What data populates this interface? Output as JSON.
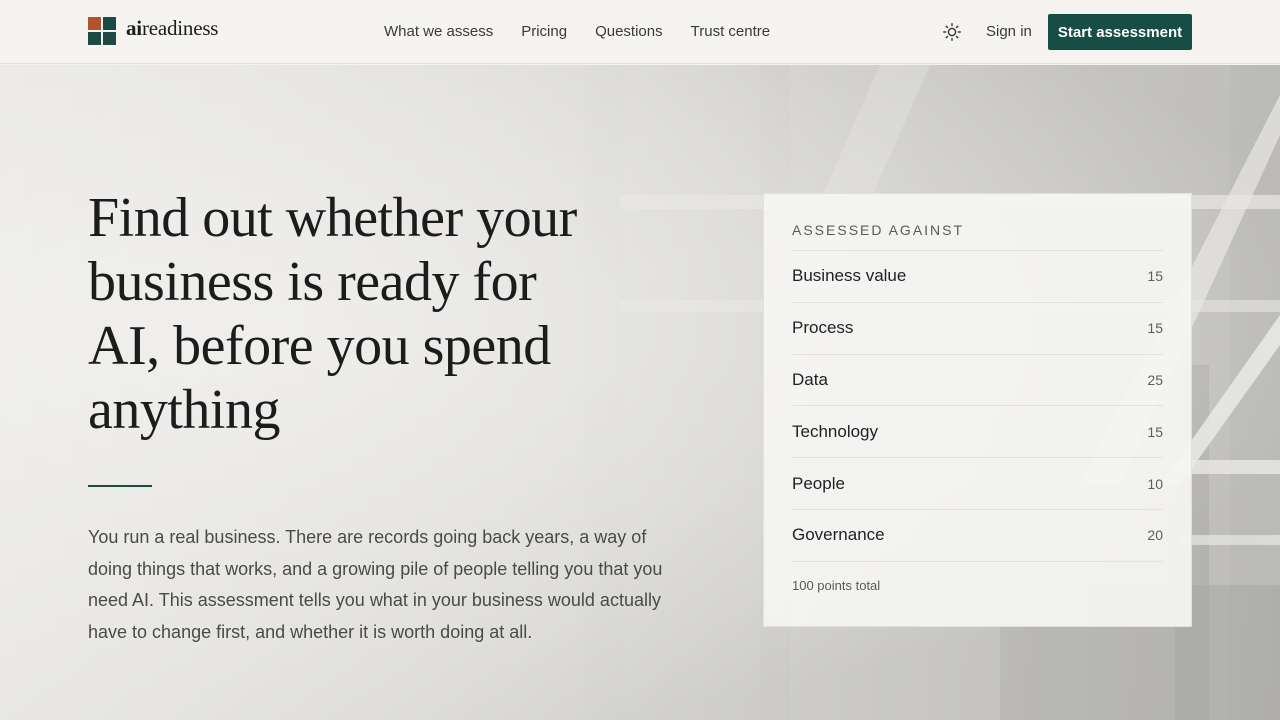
{
  "brand": {
    "name_bold": "ai",
    "name_rest": "readiness"
  },
  "nav": {
    "items": [
      "What we assess",
      "Pricing",
      "Questions",
      "Trust centre"
    ]
  },
  "header": {
    "theme_icon": "sun-icon",
    "sign_in": "Sign in",
    "cta": "Start assessment"
  },
  "colors": {
    "accent": "#184d46",
    "logo_orange": "#b2532f",
    "logo_green": "#1c4a44"
  },
  "hero": {
    "headline": "Find out whether your business is ready for AI, before you spend anything",
    "intro": "You run a real business. There are records going back years, a way of doing things that works, and a growing pile of people telling you that you need AI. This assessment tells you what in your business would actually have to change first, and whether it is worth doing at all."
  },
  "card": {
    "title": "ASSESSED AGAINST",
    "rows": [
      {
        "name": "Business value",
        "points": "15"
      },
      {
        "name": "Process",
        "points": "15"
      },
      {
        "name": "Data",
        "points": "25"
      },
      {
        "name": "Technology",
        "points": "15"
      },
      {
        "name": "People",
        "points": "10"
      },
      {
        "name": "Governance",
        "points": "20"
      }
    ],
    "footer": "100 points total"
  }
}
